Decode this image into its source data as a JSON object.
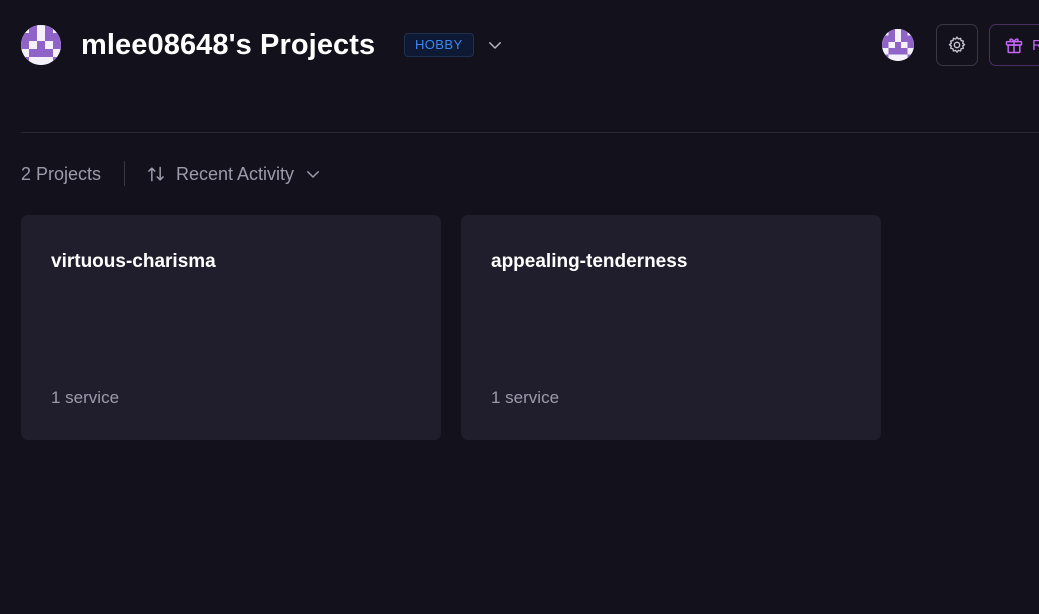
{
  "header": {
    "title": "mlee08648's Projects",
    "plan_badge": "HOBBY",
    "team_avatar_icon": "checker-avatar-icon",
    "user_avatar_icon": "checker-avatar-icon",
    "settings_icon": "gear-icon",
    "referral_icon": "gift-icon",
    "referral_label": "R"
  },
  "toolbar": {
    "project_count": "2 Projects",
    "sort_icon": "sort-arrows-icon",
    "sort_label": "Recent Activity"
  },
  "projects": [
    {
      "name": "virtuous-charisma",
      "services": "1 service"
    },
    {
      "name": "appealing-tenderness",
      "services": "1 service"
    }
  ],
  "colors": {
    "background": "#13111c",
    "card": "#201e2c",
    "badge_text": "#3e86f2",
    "referral_accent": "#c467f5",
    "avatar_purple": "#8f63c8"
  }
}
